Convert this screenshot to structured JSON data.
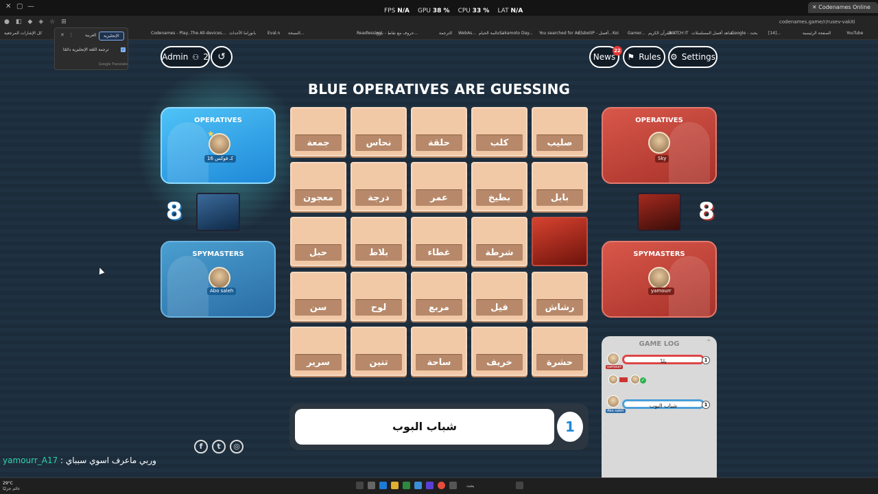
{
  "overlay": {
    "fps_label": "FPS",
    "fps_value": "N/A",
    "gpu_label": "GPU",
    "gpu_value": "38 %",
    "cpu_label": "CPU",
    "cpu_value": "33 %",
    "lat_label": "LAT",
    "lat_value": "N/A"
  },
  "browser": {
    "tab_title": "Codenames Online",
    "url": "codenames.game/r/rusev-vakiti",
    "bookmarks": [
      "كل الإشارات المرجعية",
      "Codenames - Play...",
      "The All-devices...",
      "بانوراما الأحداث",
      "Eval.n",
      "النسخة...",
      "Readlessing",
      "حروف مع نقاط - بانتح...",
      "الترجمة",
      "WebAs...",
      "عالمة الخيام...",
      "Sakamoto Day...",
      "You searched for Av...",
      "ElsbetIP - أفضل...",
      "Koi",
      "Gamer...",
      "القرآن الكريم...",
      "WATCH IT",
      "شاهد أفضل المسلسلات...",
      "Google - بحث",
      "[14]...",
      "الصفحة الرئيسية",
      "YouTube"
    ]
  },
  "translate_popup": {
    "tab_english": "الإنجليزية",
    "tab_arabic": "العربية",
    "always_translate": "ترجمة اللغة الإنجليزية دائمًا",
    "footer": "Google Translate"
  },
  "top_controls": {
    "admin_label": "Admin",
    "player_count": "2",
    "news_label": "News",
    "news_badge": "22",
    "rules_label": "Rules",
    "settings_label": "Settings"
  },
  "headline": "BLUE OPERATIVES ARE GUESSING",
  "blue_team": {
    "operatives_title": "OPERATIVES",
    "operative_name": "كـ فوكس 16",
    "spymasters_title": "SPYMASTERS",
    "spymaster_name": "Abo saleh",
    "score": "8",
    "color": "#1e88d8"
  },
  "red_team": {
    "operatives_title": "OPERATIVES",
    "operative_name": "Sky",
    "spymasters_title": "SPYMASTERS",
    "spymaster_name": "yamourr",
    "score": "8",
    "color": "#c0392b"
  },
  "board": {
    "rows": [
      [
        "جمعة",
        "نحاس",
        "حلقة",
        "كلب",
        "صليب"
      ],
      [
        "معجون",
        "درجة",
        "عمر",
        "بطيخ",
        "بابل"
      ],
      [
        "حبل",
        "بلاط",
        "غطاء",
        "شرطة",
        ""
      ],
      [
        "سن",
        "لوح",
        "مربع",
        "فيل",
        "رشاش"
      ],
      [
        "سرير",
        "تنين",
        "ساحة",
        "خريف",
        "حشرة"
      ]
    ],
    "revealed": [
      {
        "row": 2,
        "col": 4,
        "team": "red"
      }
    ]
  },
  "clue": {
    "word": "شباب البوب",
    "number": "1"
  },
  "game_log": {
    "title": "GAME LOG",
    "entries": [
      {
        "player": "yamourr",
        "team": "red",
        "clue": "يلدّ",
        "count": "1"
      },
      {
        "player": "Abo saleh",
        "team": "blue",
        "clue": "شباب البوب",
        "count": "1"
      }
    ]
  },
  "social": [
    "facebook-icon",
    "twitter-icon",
    "instagram-icon"
  ],
  "chat": {
    "user": "yamourr_A17",
    "separator": " : ",
    "message": "وربي ماعرف اسوي سبباي"
  },
  "taskbar": {
    "search_placeholder": "بحث",
    "time": "29°C",
    "weather": "غائم جزئيًا"
  }
}
